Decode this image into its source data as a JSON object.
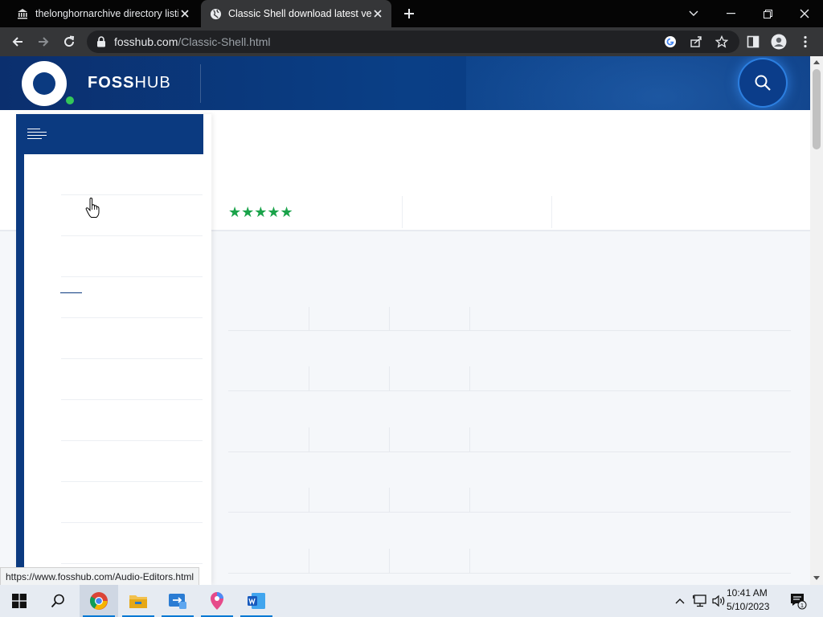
{
  "browser": {
    "tabs": [
      {
        "title": "thelonghornarchive directory listi",
        "active": false
      },
      {
        "title": "Classic Shell download latest vers",
        "active": true
      }
    ],
    "url_domain": "fosshub.com",
    "url_path": "/Classic-Shell.html"
  },
  "site": {
    "brand_foss": "FOSS",
    "brand_hub": "HUB",
    "rating_stars": "★★★★★",
    "rating_value": 5,
    "rating_max": 5
  },
  "status_bar": {
    "hover_url": "https://www.fosshub.com/Audio-Editors.html"
  },
  "taskbar": {
    "apps": [
      "windows-start",
      "search",
      "chrome",
      "file-explorer",
      "remote-desktop",
      "maps",
      "word"
    ],
    "time": "10:41 AM",
    "date": "5/10/2023",
    "notification_count": "1"
  },
  "colors": {
    "header_blue": "#0b3a80",
    "accent_green": "#34c759",
    "star_green": "#1aa34a"
  }
}
